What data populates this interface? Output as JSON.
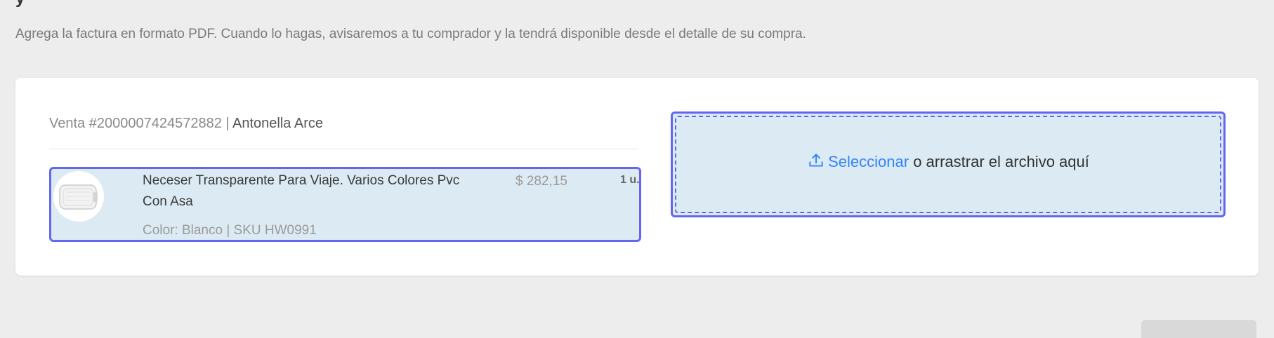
{
  "page": {
    "intro_text": "Agrega la factura en formato PDF. Cuando lo hagas, avisaremos a tu comprador y la tendrá disponible desde el detalle de su compra."
  },
  "sale": {
    "label": "Venta #2000007424572882",
    "separator": " | ",
    "buyer": "Antonella Arce"
  },
  "product": {
    "title": "Neceser Transparente Para Viaje. Varios Colores Pvc Con Asa",
    "attributes": "Color: Blanco | SKU HW0991",
    "price": "$ 282,15",
    "quantity": "1 u.",
    "thumbnail_icon": "product-thumbnail"
  },
  "upload": {
    "icon": "upload-icon",
    "link_label": "Seleccionar",
    "rest_label": " o arrastrar el archivo aquí"
  },
  "colors": {
    "accent": "#6367ef",
    "link": "#3483fa",
    "selected_bg": "#dcebf3",
    "page_bg": "#ededed"
  }
}
